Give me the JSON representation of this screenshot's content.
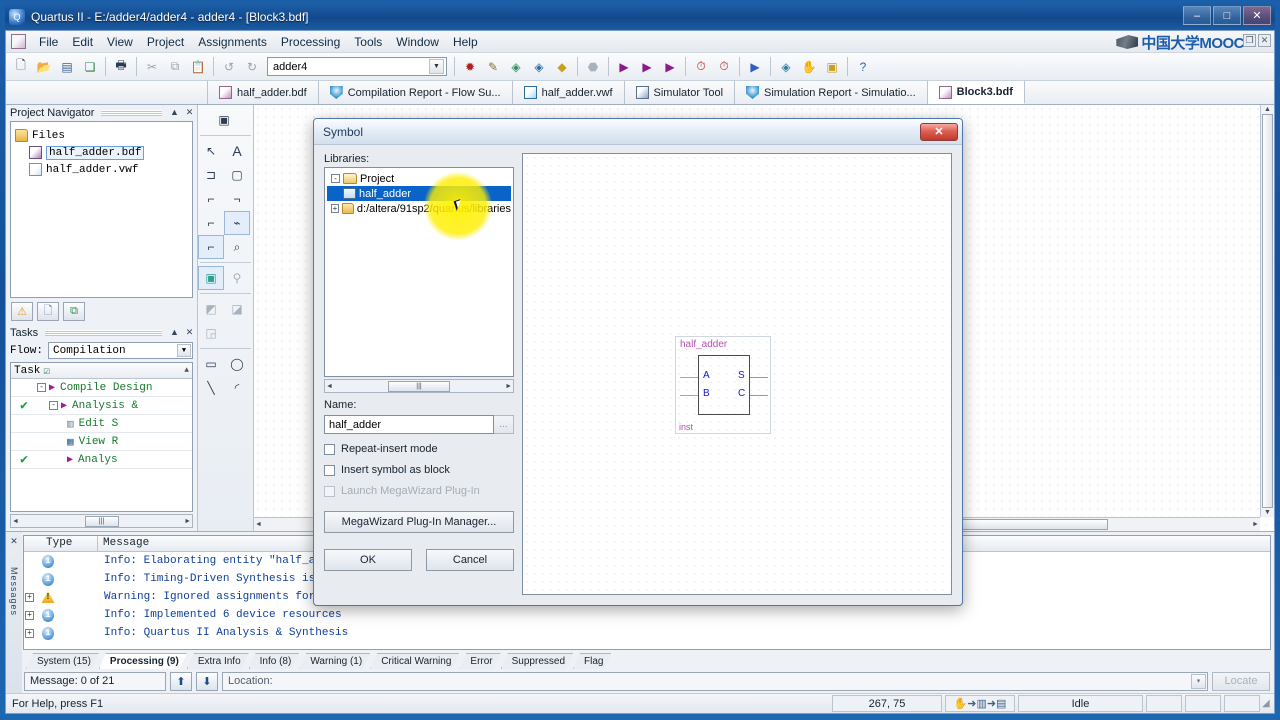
{
  "window": {
    "title": "Quartus II - E:/adder4/adder4 - adder4 - [Block3.bdf]",
    "icon": "quartus-icon",
    "minimize": "–",
    "maximize": "□",
    "close": "✕"
  },
  "menubar": {
    "items": [
      "File",
      "Edit",
      "View",
      "Project",
      "Assignments",
      "Processing",
      "Tools",
      "Window",
      "Help"
    ],
    "watermark": "中国大学MOOC",
    "mdi_restore": "❐",
    "mdi_close": "✕"
  },
  "toolbar": {
    "project_combo_value": "adder4",
    "buttons": [
      {
        "name": "new-file-icon",
        "glyph": "🗋"
      },
      {
        "name": "open-file-icon",
        "glyph": "📂"
      },
      {
        "name": "save-file-icon",
        "glyph": "💾"
      },
      {
        "name": "save-all-icon",
        "glyph": "🗗"
      },
      {
        "name": "print-icon",
        "glyph": "🖨"
      },
      {
        "name": "cut-icon",
        "glyph": "✂"
      },
      {
        "name": "copy-icon",
        "glyph": "⧉"
      },
      {
        "name": "paste-icon",
        "glyph": "📋"
      },
      {
        "name": "undo-icon",
        "glyph": "↶"
      },
      {
        "name": "redo-icon",
        "glyph": "↷"
      }
    ],
    "buttons_right": [
      {
        "name": "start-compilation-icon",
        "glyph": "✹"
      },
      {
        "name": "analysis-synthesis-icon",
        "glyph": "✎"
      },
      {
        "name": "fitter-icon",
        "glyph": "◈"
      },
      {
        "name": "assembler-icon",
        "glyph": "◆"
      },
      {
        "name": "timing-analyzer-icon",
        "glyph": "◇"
      },
      {
        "name": "stop-icon",
        "glyph": "⬣"
      },
      {
        "name": "start-compilation-play-icon",
        "glyph": "▶"
      },
      {
        "name": "compile-check-icon",
        "glyph": "▶"
      },
      {
        "name": "compile-report-icon",
        "glyph": "▶"
      },
      {
        "name": "timing-sim-icon",
        "glyph": "⏱"
      },
      {
        "name": "stopwatch-icon",
        "glyph": "⏱"
      },
      {
        "name": "simulator-run-icon",
        "glyph": "▶"
      },
      {
        "name": "programmer-icon",
        "glyph": "◈"
      },
      {
        "name": "pin-planner-icon",
        "glyph": "✋"
      },
      {
        "name": "chip-planner-icon",
        "glyph": "▣"
      },
      {
        "name": "help-icon",
        "glyph": "?"
      }
    ]
  },
  "doctabs": [
    {
      "label": "half_adder.bdf",
      "icon": "bdf",
      "active": false
    },
    {
      "label": "Compilation Report - Flow Su...",
      "icon": "rpt",
      "active": false
    },
    {
      "label": "half_adder.vwf",
      "icon": "vwf",
      "active": false
    },
    {
      "label": "Simulator Tool",
      "icon": "sim",
      "active": false
    },
    {
      "label": "Simulation Report - Simulatio...",
      "icon": "rpt",
      "active": false
    },
    {
      "label": "Block3.bdf",
      "icon": "bdf",
      "active": true
    }
  ],
  "project_navigator": {
    "title": "Project Navigator",
    "collapse": "▲",
    "close": "✕",
    "tree": [
      {
        "label": "Files",
        "icon": "folder",
        "indent": 0,
        "selected": false
      },
      {
        "label": "half_adder.bdf",
        "icon": "bdf2",
        "indent": 1,
        "selected": true
      },
      {
        "label": "half_adder.vwf",
        "icon": "wave",
        "indent": 1,
        "selected": false
      }
    ],
    "tabs": [
      {
        "name": "hierarchy-tab-icon",
        "glyph": "⚠"
      },
      {
        "name": "files-tab-icon",
        "glyph": "🗋"
      },
      {
        "name": "design-units-tab-icon",
        "glyph": "⧉"
      }
    ]
  },
  "tasks": {
    "title": "Tasks",
    "collapse": "▲",
    "close": "✕",
    "flow_label": "Flow:",
    "flow_value": "Compilation",
    "column_header": "Task",
    "header_check": "☑",
    "rows": [
      {
        "check": "",
        "label": "Compile Design",
        "indent": 22,
        "expander": "-",
        "play": true
      },
      {
        "check": "✔",
        "label": "Analysis &",
        "indent": 34,
        "expander": "-",
        "play": true
      },
      {
        "check": "",
        "label": "Edit S",
        "indent": 56,
        "expander": "",
        "play": false,
        "icon": "edit-settings-icon"
      },
      {
        "check": "",
        "label": "View R",
        "indent": 56,
        "expander": "",
        "play": false,
        "icon": "view-report-icon"
      },
      {
        "check": "✔",
        "label": "Analys",
        "indent": 56,
        "expander": "",
        "play": true
      }
    ],
    "scroll_left": "◄",
    "scroll_right": "►",
    "scroll_grip": "|||"
  },
  "drawing_toolbar": [
    {
      "name": "symbol-tool-icon",
      "glyph": "▣",
      "state": "normal"
    },
    {
      "name": "selection-tool-icon",
      "glyph": "↖",
      "state": "normal"
    },
    {
      "name": "text-tool-icon",
      "glyph": "A",
      "state": "normal"
    },
    {
      "name": "symbol-gate-icon",
      "glyph": "⊐",
      "state": "normal"
    },
    {
      "name": "block-tool-icon",
      "glyph": "▢",
      "state": "normal"
    },
    {
      "name": "orthogonal-node-tool-icon",
      "glyph": "⌐",
      "state": "normal"
    },
    {
      "name": "orthogonal-bus-tool-icon",
      "glyph": "¬",
      "state": "normal"
    },
    {
      "name": "orthogonal-conduit-tool-icon",
      "glyph": "⌐",
      "state": "normal"
    },
    {
      "name": "rubberbanding-icon",
      "glyph": "⌁",
      "state": "box"
    },
    {
      "name": "partial-line-select-icon",
      "glyph": "⌐",
      "state": "on"
    },
    {
      "name": "zoom-tool-icon",
      "glyph": "🔍",
      "state": "normal"
    },
    {
      "name": "fit-in-window-icon",
      "glyph": "▣",
      "state": "on"
    },
    {
      "name": "find-icon",
      "glyph": "⚲",
      "state": "disabled"
    },
    {
      "name": "flip-horizontal-icon",
      "glyph": "◩",
      "state": "disabled"
    },
    {
      "name": "flip-vertical-icon",
      "glyph": "◪",
      "state": "disabled"
    },
    {
      "name": "rotate-icon",
      "glyph": "◲",
      "state": "disabled"
    },
    {
      "name": "rectangle-tool-icon",
      "glyph": "▭",
      "state": "normal"
    },
    {
      "name": "ellipse-tool-icon",
      "glyph": "◯",
      "state": "normal"
    },
    {
      "name": "line-tool-icon",
      "glyph": "╲",
      "state": "normal"
    },
    {
      "name": "arc-tool-icon",
      "glyph": "◜",
      "state": "normal"
    }
  ],
  "dialog": {
    "title": "Symbol",
    "close": "✕",
    "libraries_label": "Libraries:",
    "tree": [
      {
        "label": "Project",
        "expander": "-",
        "icon": "folder-open",
        "indent": 0,
        "selected": false
      },
      {
        "label": "half_adder",
        "expander": "",
        "icon": "chip",
        "indent": 1,
        "selected": true
      },
      {
        "label": "d:/altera/91sp2/quartus/libraries",
        "expander": "+",
        "icon": "folder",
        "indent": 0,
        "selected": false
      }
    ],
    "scroll_left": "◄",
    "scroll_right": "►",
    "scroll_grip": "|||",
    "name_label": "Name:",
    "name_value": "half_adder",
    "browse": "...",
    "checkboxes": [
      {
        "label": "Repeat-insert mode",
        "checked": false,
        "disabled": false
      },
      {
        "label": "Insert symbol as block",
        "checked": false,
        "disabled": false
      },
      {
        "label": "Launch MegaWizard Plug-In",
        "checked": false,
        "disabled": true
      }
    ],
    "megawizard_button": "MegaWizard Plug-In Manager...",
    "ok_button": "OK",
    "cancel_button": "Cancel",
    "preview": {
      "symbol_name": "half_adder",
      "instance": "inst",
      "inputs": [
        "A",
        "B"
      ],
      "outputs": [
        "S",
        "C"
      ]
    }
  },
  "messages": {
    "side_label": "Messages",
    "columns": [
      "Type",
      "Message"
    ],
    "rows": [
      {
        "expander": "",
        "type": "info",
        "text": "Info: Elaborating entity \"half_adder\""
      },
      {
        "expander": "",
        "type": "info",
        "text": "Info: Timing-Driven Synthesis is runn"
      },
      {
        "expander": "+",
        "type": "warning",
        "text": "Warning: Ignored assignments for enti"
      },
      {
        "expander": "+",
        "type": "info",
        "text": "Info: Implemented 6 device resources"
      },
      {
        "expander": "+",
        "type": "info",
        "text": "Info: Quartus II Analysis & Synthesis"
      }
    ],
    "tabs": [
      {
        "label": "System (15)",
        "active": false
      },
      {
        "label": "Processing (9)",
        "active": true
      },
      {
        "label": "Extra Info",
        "active": false
      },
      {
        "label": "Info (8)",
        "active": false
      },
      {
        "label": "Warning (1)",
        "active": false
      },
      {
        "label": "Critical Warning",
        "active": false
      },
      {
        "label": "Error",
        "active": false
      },
      {
        "label": "Suppressed",
        "active": false
      },
      {
        "label": "Flag",
        "active": false
      }
    ],
    "counter": "Message: 0 of 21",
    "prev_glyph": "⬆",
    "next_glyph": "⬇",
    "location_label": "Location:",
    "location_arrow": "▾",
    "locate_button": "Locate"
  },
  "statusbar": {
    "help_text": "For Help, press F1",
    "coordinates": "267, 75",
    "mode_icon": "pointer-mode-icon",
    "state": "Idle"
  }
}
